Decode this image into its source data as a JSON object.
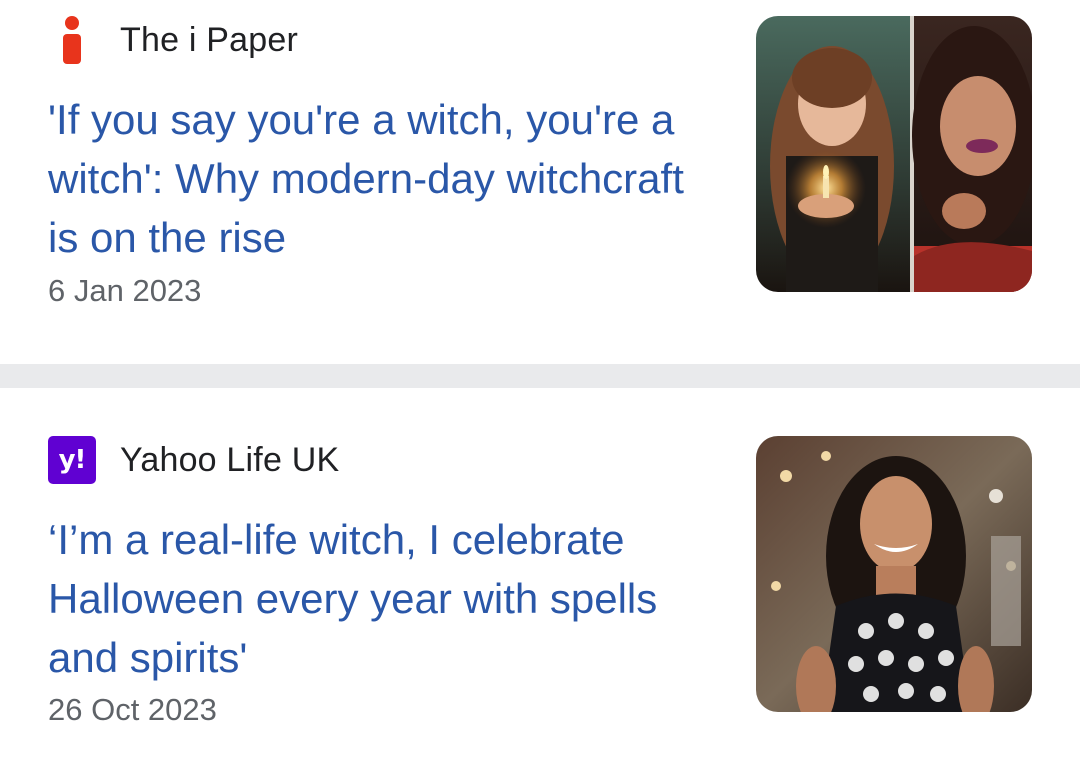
{
  "articles": [
    {
      "source": "The i Paper",
      "source_logo": "i-paper-logo",
      "headline": "'If you say you're a witch, you're a witch': Why modern-day witchcraft is on the rise",
      "date": "6 Jan 2023",
      "thumbnail": "photo-two-women-candle-split"
    },
    {
      "source": "Yahoo Life UK",
      "source_logo": "yahoo-logo",
      "logo_text": "y!",
      "headline": "‘I’m a real-life witch, I celebrate Halloween every year with spells and spirits'",
      "date": "26 Oct 2023",
      "thumbnail": "photo-smiling-woman-skull-dress"
    }
  ],
  "colors": {
    "headline": "#2a57a8",
    "source_text": "#202124",
    "date_text": "#5f6368",
    "divider": "#e9eaec",
    "i_paper_red": "#e8341c",
    "yahoo_purple": "#6001d2"
  }
}
